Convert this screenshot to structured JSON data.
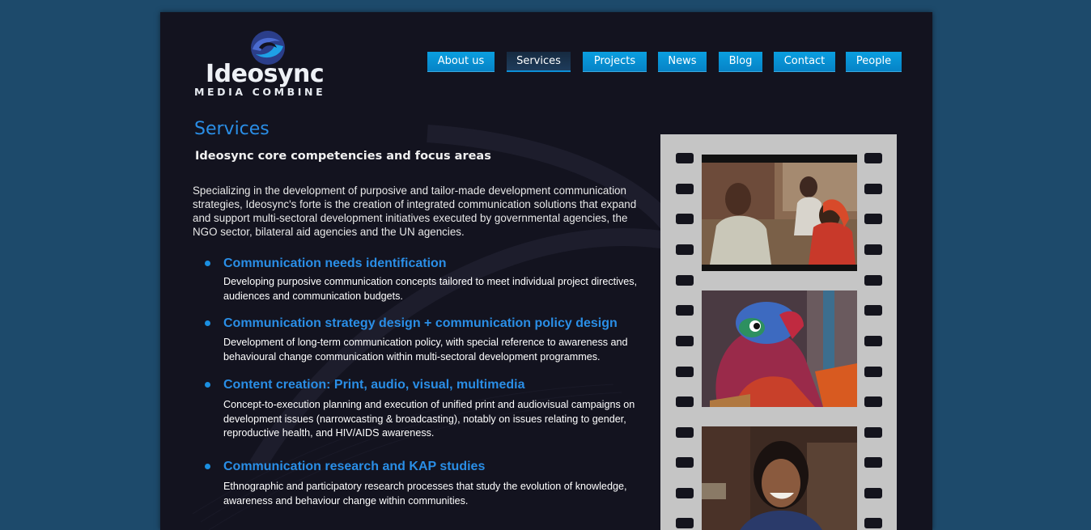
{
  "logo": {
    "name": "Ideosync",
    "tagline": "MEDIA COMBINE"
  },
  "nav": {
    "items": [
      {
        "label": "About us"
      },
      {
        "label": "Services"
      },
      {
        "label": "Projects"
      },
      {
        "label": "News"
      },
      {
        "label": "Blog"
      },
      {
        "label": "Contact"
      },
      {
        "label": "People"
      }
    ],
    "active": "Services"
  },
  "page": {
    "title": "Services",
    "subtitle": "Ideosync core competencies and focus areas",
    "intro": "Specializing in the development of purposive and tailor-made development communication strategies, Ideosync's forte is the creation of integrated communication solutions that expand and support multi-sectoral development initiatives executed by  governmental agencies, the NGO sector, bilateral aid agencies and the UN agencies."
  },
  "services": [
    {
      "title": "Communication needs identification",
      "description": "Developing purposive communication concepts tailored to meet individual project directives, audiences and communication budgets."
    },
    {
      "title": "Communication strategy design + communication policy design",
      "description": "Development of long-term communication policy, with special reference to awareness and behavioural change communication within multi-sectoral development programmes."
    },
    {
      "title": "Content creation: Print, audio, visual, multimedia",
      "description": "Concept-to-execution planning and execution of unified print and audiovisual campaigns on development issues (narrowcasting & broadcasting), notably on issues relating to gender, reproductive health, and HIV/AIDS awareness."
    },
    {
      "title": "Communication research and KAP studies",
      "description": "Ethnographic and participatory research processes that study the evolution of knowledge, awareness and behaviour change within communities."
    }
  ],
  "colors": {
    "background": "#1d4a6b",
    "page": "#13131f",
    "accent": "#2a8ee6",
    "nav_button": "#0a9fe0",
    "nav_active": "#162a40",
    "filmstrip": "#c5c5c5"
  },
  "icons": {
    "logo_mark": "swirl-logo-icon",
    "bullet": "bullet-dot-icon"
  }
}
